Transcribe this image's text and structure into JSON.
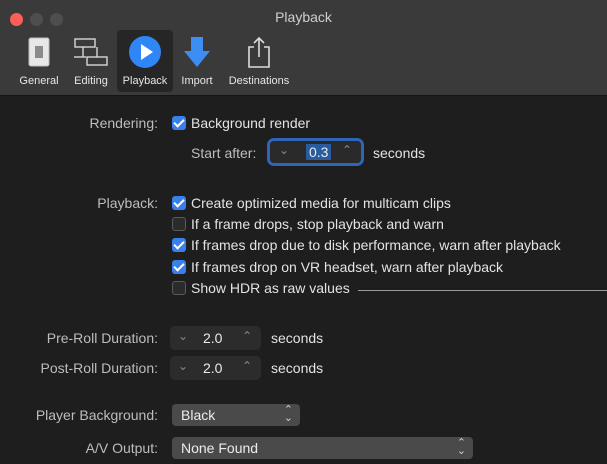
{
  "window": {
    "title": "Playback"
  },
  "toolbar": {
    "items": [
      {
        "label": "General",
        "icon": "light-switch-icon"
      },
      {
        "label": "Editing",
        "icon": "film-strip-icon"
      },
      {
        "label": "Playback",
        "icon": "play-circle-icon",
        "active": true
      },
      {
        "label": "Import",
        "icon": "down-arrow-icon"
      },
      {
        "label": "Destinations",
        "icon": "share-icon"
      }
    ]
  },
  "rendering": {
    "label": "Rendering:",
    "background_render": {
      "label": "Background render",
      "checked": true
    },
    "start_after": {
      "label": "Start after:",
      "value": "0.3",
      "unit": "seconds"
    }
  },
  "playback": {
    "label": "Playback:",
    "options": [
      {
        "label": "Create optimized media for multicam clips",
        "checked": true
      },
      {
        "label": "If a frame drops, stop playback and warn",
        "checked": false
      },
      {
        "label": "If frames drop due to disk performance, warn after playback",
        "checked": true
      },
      {
        "label": "If frames drop on VR headset, warn after playback",
        "checked": true
      },
      {
        "label": "Show HDR as raw values",
        "checked": false
      }
    ]
  },
  "pre_roll": {
    "label": "Pre-Roll Duration:",
    "value": "2.0",
    "unit": "seconds"
  },
  "post_roll": {
    "label": "Post-Roll Duration:",
    "value": "2.0",
    "unit": "seconds"
  },
  "player_background": {
    "label": "Player Background:",
    "value": "Black"
  },
  "av_output": {
    "label": "A/V Output:",
    "value": "None Found"
  },
  "colors": {
    "accent": "#3880ee",
    "close": "#fd5f57",
    "focus": "#2e65b8"
  }
}
